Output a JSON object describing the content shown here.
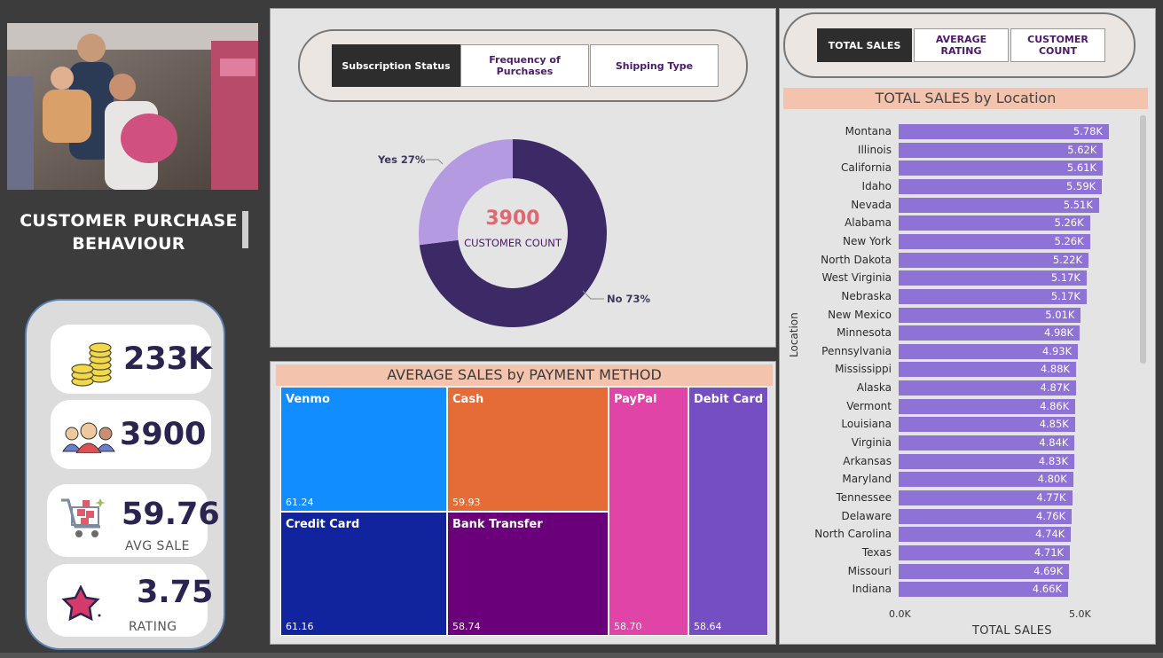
{
  "sidebar": {
    "title_line1": "CUSTOMER  PURCHASE",
    "title_line2": "BEHAVIOUR",
    "kpis": {
      "total_sales": "233K",
      "customer_count": "3900",
      "avg_sale": "59.76",
      "avg_sale_label": "AVG SALE",
      "rating": "3.75",
      "rating_label": "RATING"
    }
  },
  "donut_section": {
    "buttons": [
      "Subscription Status",
      "Frequency of Purchases",
      "Shipping Type"
    ],
    "active_button": "Subscription Status",
    "center_value": "3900",
    "center_label": "CUSTOMER COUNT",
    "label_yes": "Yes 27%",
    "label_no": "No 73%",
    "colors": {
      "yes": "#b49ae0",
      "no": "#3b2a66",
      "center_value": "#e06870"
    }
  },
  "payment_section": {
    "title": "AVERAGE SALES by PAYMENT METHOD",
    "tiles": [
      {
        "name": "Venmo",
        "value": "61.24",
        "color": "#118dff"
      },
      {
        "name": "Cash",
        "value": "59.93",
        "color": "#e66c37"
      },
      {
        "name": "PayPal",
        "value": "58.70",
        "color": "#e044a7"
      },
      {
        "name": "Debit Card",
        "value": "58.64",
        "color": "#744ec2"
      },
      {
        "name": "Credit Card",
        "value": "61.16",
        "color": "#12239e"
      },
      {
        "name": "Bank Transfer",
        "value": "58.74",
        "color": "#6b007b"
      }
    ]
  },
  "location_section": {
    "buttons": [
      "TOTAL SALES",
      "AVERAGE RATING",
      "CUSTOMER COUNT"
    ],
    "active_button": "TOTAL SALES",
    "chart_title": "TOTAL SALES by Location",
    "y_axis_label": "Location",
    "x_axis_label": "TOTAL SALES",
    "x_ticks": [
      "0.0K",
      "5.0K"
    ]
  },
  "chart_data": {
    "type": "bar",
    "orientation": "horizontal",
    "title": "TOTAL SALES by Location",
    "xlabel": "TOTAL SALES",
    "ylabel": "Location",
    "xlim": [
      0,
      6000
    ],
    "bar_color": "#8f72d6",
    "categories": [
      "Montana",
      "Illinois",
      "California",
      "Idaho",
      "Nevada",
      "Alabama",
      "New York",
      "North Dakota",
      "West Virginia",
      "Nebraska",
      "New Mexico",
      "Minnesota",
      "Pennsylvania",
      "Mississippi",
      "Alaska",
      "Vermont",
      "Louisiana",
      "Virginia",
      "Arkansas",
      "Maryland",
      "Tennessee",
      "Delaware",
      "North Carolina",
      "Texas",
      "Missouri",
      "Indiana"
    ],
    "values": [
      5780,
      5620,
      5610,
      5590,
      5510,
      5260,
      5260,
      5220,
      5170,
      5170,
      5010,
      4980,
      4930,
      4880,
      4870,
      4860,
      4850,
      4840,
      4830,
      4800,
      4770,
      4760,
      4740,
      4710,
      4690,
      4660
    ],
    "labels": [
      "5.78K",
      "5.62K",
      "5.61K",
      "5.59K",
      "5.51K",
      "5.26K",
      "5.26K",
      "5.22K",
      "5.17K",
      "5.17K",
      "5.01K",
      "4.98K",
      "4.93K",
      "4.88K",
      "4.87K",
      "4.86K",
      "4.85K",
      "4.84K",
      "4.83K",
      "4.80K",
      "4.77K",
      "4.76K",
      "4.74K",
      "4.71K",
      "4.69K",
      "4.66K"
    ]
  }
}
